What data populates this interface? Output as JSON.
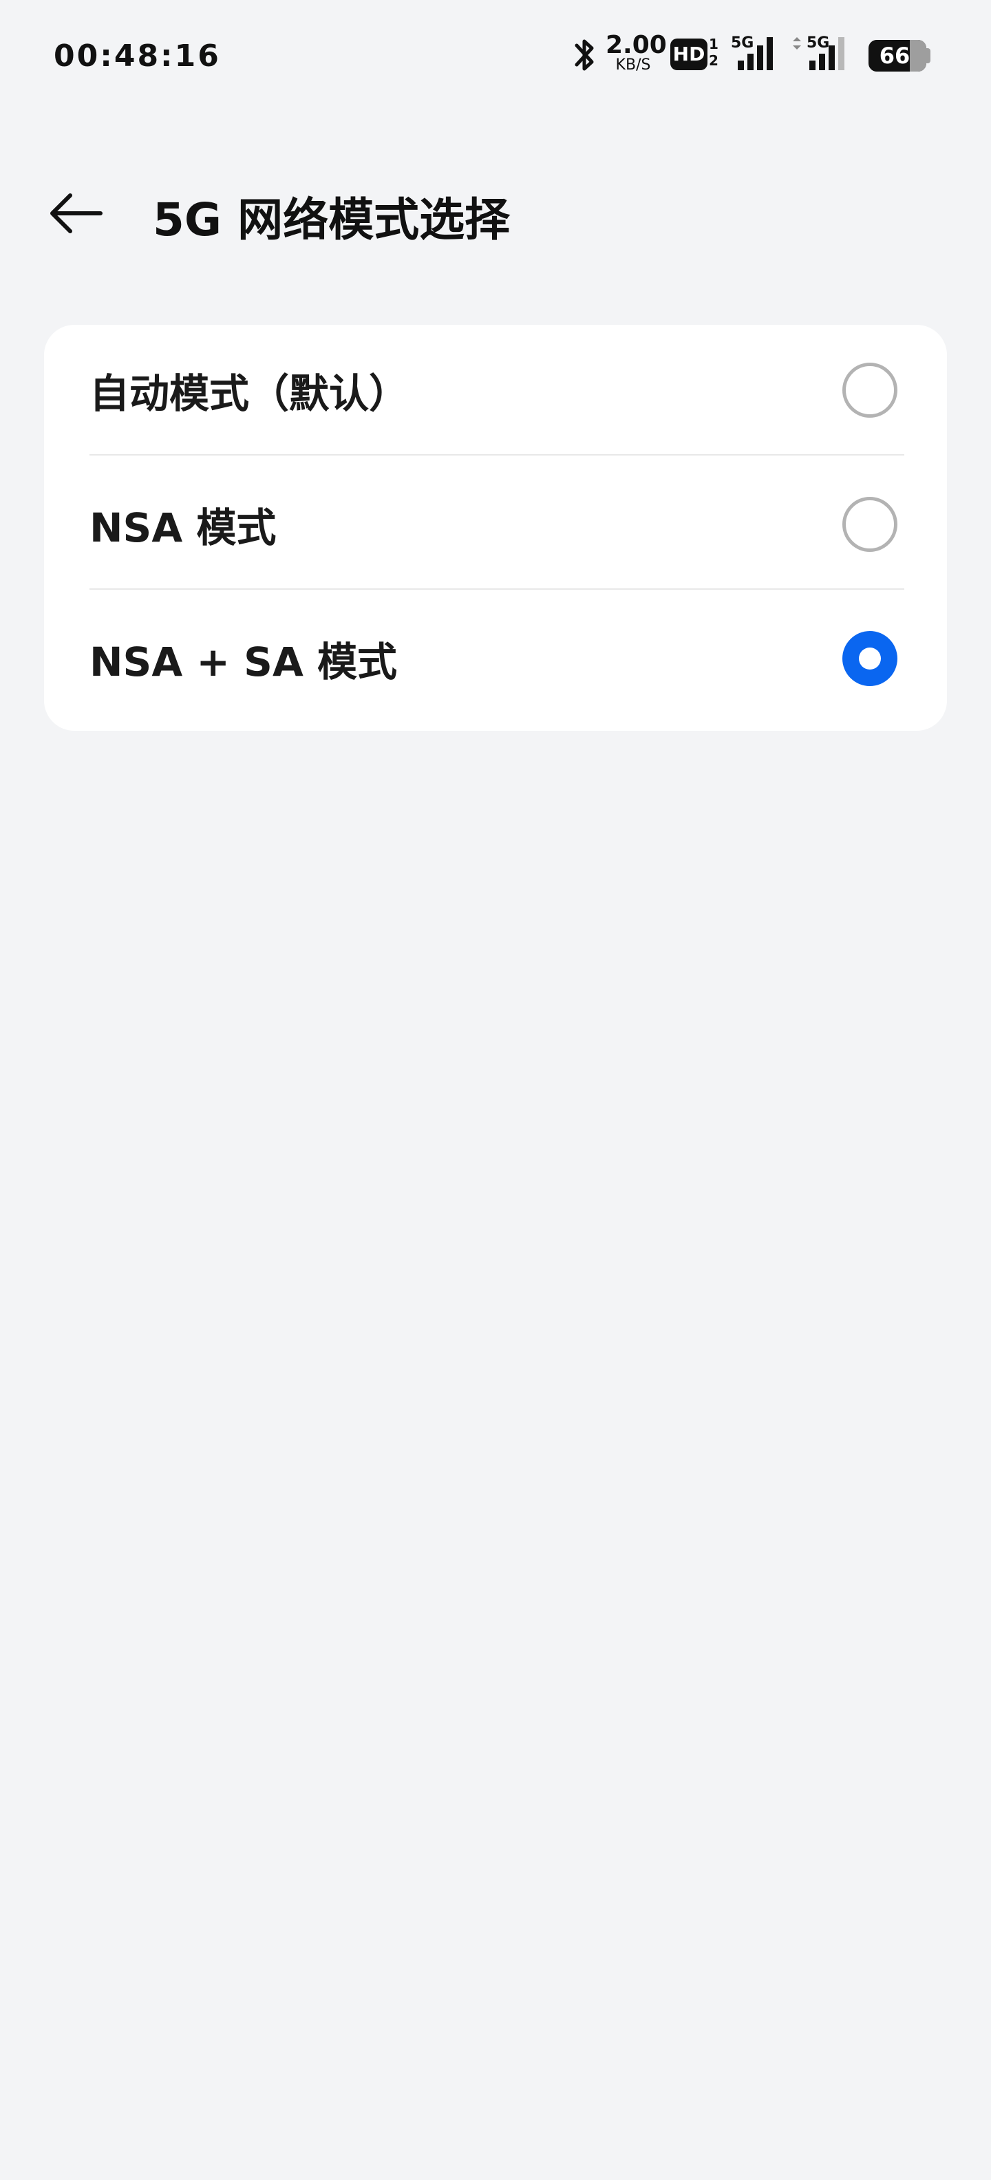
{
  "status_bar": {
    "time": "00:48:16",
    "bluetooth_icon": "bluetooth-icon",
    "net_speed_value": "2.00",
    "net_speed_unit": "KB/S",
    "hd_label": "HD",
    "hd_sims": [
      "1",
      "2"
    ],
    "signal_1_label": "5G",
    "signal_2_label": "5G",
    "battery_level": "66"
  },
  "header": {
    "back_icon": "arrow-left-icon",
    "title": "5G 网络模式选择"
  },
  "options": [
    {
      "label": "自动模式（默认）",
      "selected": false
    },
    {
      "label": "NSA 模式",
      "selected": false
    },
    {
      "label": "NSA + SA 模式",
      "selected": true
    }
  ],
  "colors": {
    "accent": "#0a66f0",
    "background": "#f3f4f6",
    "card": "#ffffff",
    "radio_unselected": "#b3b3b3"
  }
}
